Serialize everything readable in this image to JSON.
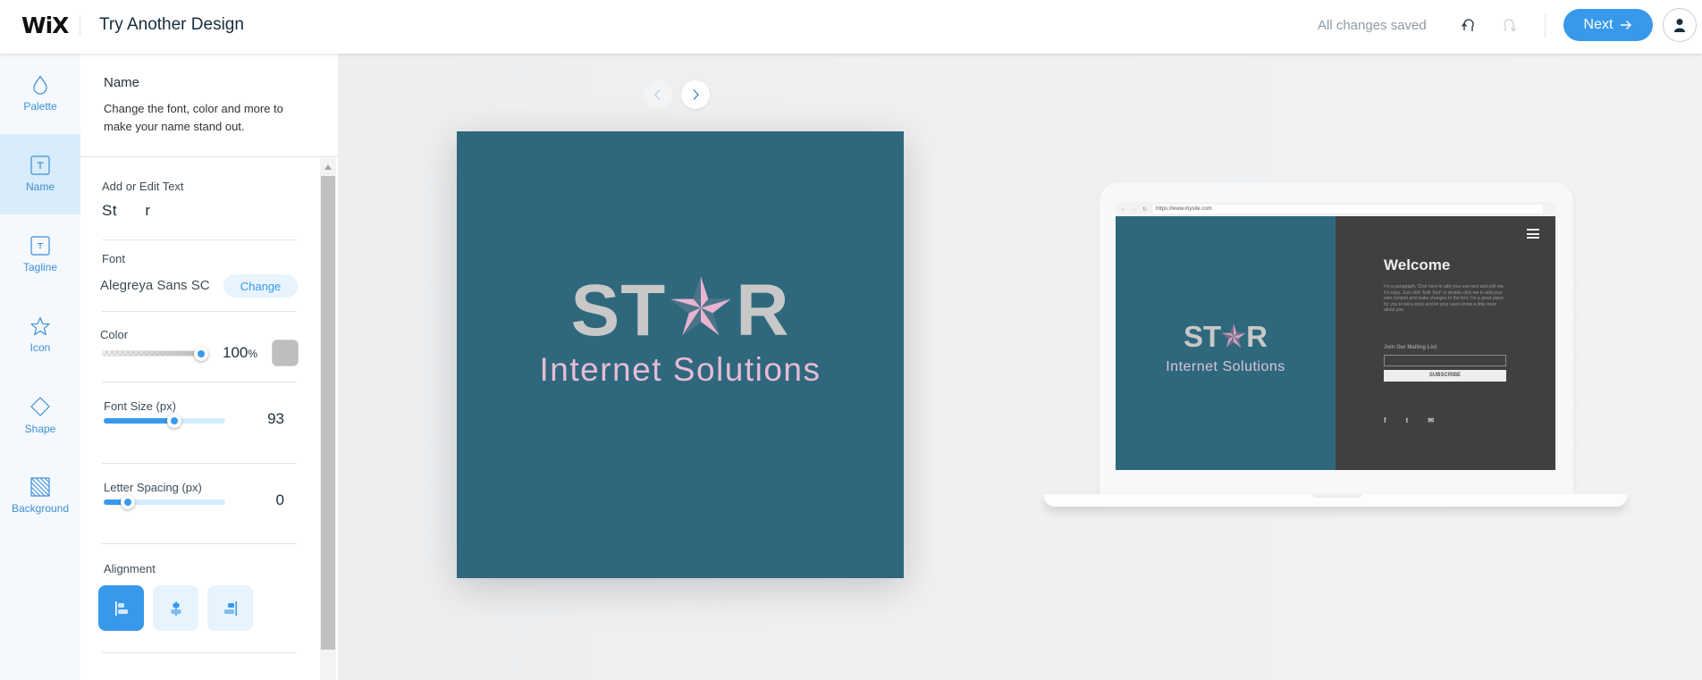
{
  "header": {
    "logo": "WiX",
    "title": "Try Another Design",
    "status": "All changes saved",
    "next_label": "Next",
    "undo": "undo-icon",
    "redo": "redo-icon"
  },
  "rail": {
    "items": [
      {
        "label": "Palette",
        "icon": "droplet-icon"
      },
      {
        "label": "Name",
        "icon": "text-icon",
        "active": true
      },
      {
        "label": "Tagline",
        "icon": "text-icon"
      },
      {
        "label": "Icon",
        "icon": "star-icon"
      },
      {
        "label": "Shape",
        "icon": "diamond-icon"
      },
      {
        "label": "Background",
        "icon": "pattern-icon"
      }
    ]
  },
  "panel": {
    "title": "Name",
    "description": "Change the font, color and more to make your name stand out.",
    "text_label": "Add or Edit Text",
    "text_value": "St      r",
    "font_label": "Font",
    "font_value": "Alegreya Sans SC",
    "change_label": "Change",
    "color_label": "Color",
    "opacity_value": "100",
    "opacity_unit": "%",
    "opacity_fraction": 1.0,
    "color_swatch": "#bebebe",
    "font_size_label": "Font Size (px)",
    "font_size_value": "93",
    "font_size_fraction": 0.58,
    "letter_spacing_label": "Letter Spacing (px)",
    "letter_spacing_value": "0",
    "letter_spacing_fraction": 0.2,
    "alignment_label": "Alignment",
    "alignment_options": [
      "left",
      "center",
      "right"
    ],
    "alignment_selected": "left"
  },
  "preview": {
    "brand_left": "ST",
    "brand_right": "R",
    "tagline": "Internet Solutions",
    "bg_color": "#2f687d",
    "text_color": "#c8c8c8",
    "tagline_color": "#e6bcd4",
    "star_color": "#e8b4d0"
  },
  "mockup": {
    "url": "https://www.mysite.com",
    "welcome": "Welcome",
    "paragraph": "I'm a paragraph. Click here to add your own text and edit me. It's easy. Just click “Edit Text” or double click me to add your own content and make changes to the font. I'm a great place for you to tell a story and let your users know a little more about you.",
    "mailing_label": "Join Our Mailing List",
    "subscribe_label": "SUBSCRIBE",
    "socials": [
      "f",
      "t",
      "✉"
    ]
  },
  "accent": "#3899ec"
}
